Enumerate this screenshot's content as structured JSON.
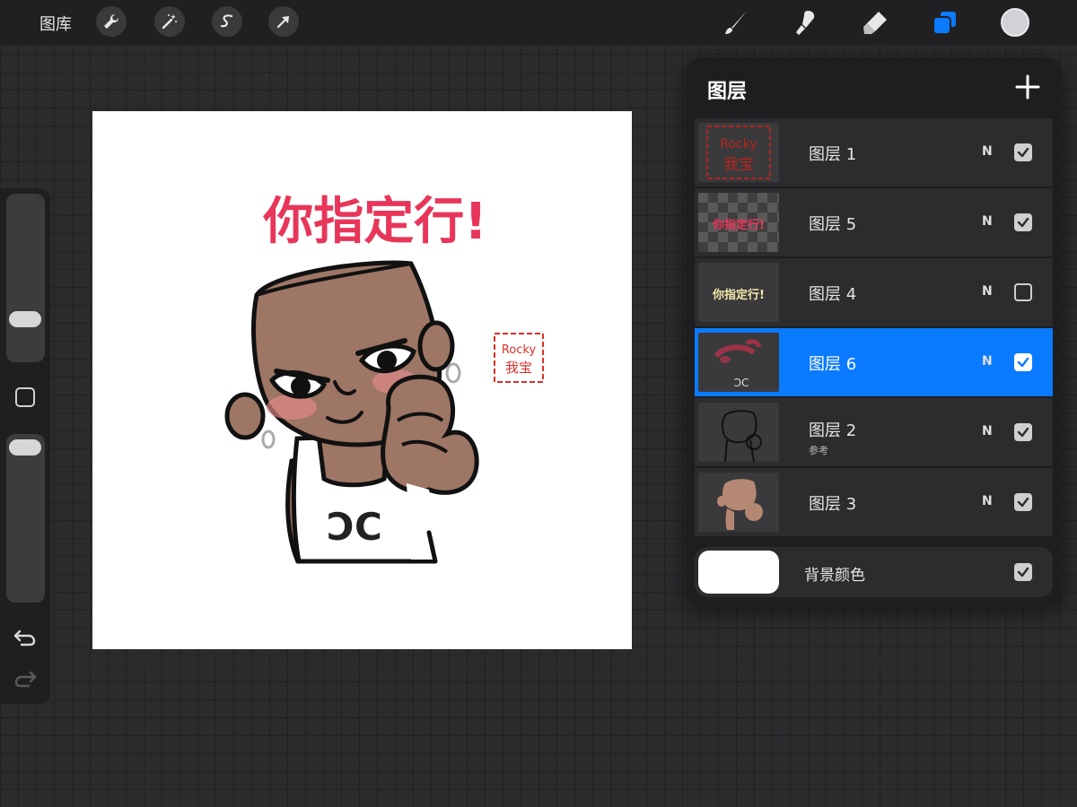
{
  "topbar": {
    "gallery_label": "图库",
    "left_tools": [
      "wrench-icon",
      "magic-wand-icon",
      "selection-icon",
      "transform-arrow-icon"
    ],
    "right_tools": [
      "brush-icon",
      "smudge-icon",
      "eraser-icon",
      "layers-icon"
    ],
    "current_color": "#d1d1d6",
    "accent_color": "#0a7aff"
  },
  "canvas": {
    "caption": "你指定行!",
    "stamp_line1": "Rocky",
    "stamp_line2": "我宝",
    "caption_color": "#e8365a",
    "skin_color": "#9e7665"
  },
  "layers_panel": {
    "title": "图层",
    "layers": [
      {
        "name": "图层 1",
        "blend": "N",
        "visible": true,
        "selected": false,
        "sublabel": ""
      },
      {
        "name": "图层 5",
        "blend": "N",
        "visible": true,
        "selected": false,
        "sublabel": ""
      },
      {
        "name": "图层 4",
        "blend": "N",
        "visible": false,
        "selected": false,
        "sublabel": ""
      },
      {
        "name": "图层 6",
        "blend": "N",
        "visible": true,
        "selected": true,
        "sublabel": ""
      },
      {
        "name": "图层 2",
        "blend": "N",
        "visible": true,
        "selected": false,
        "sublabel": "参考"
      },
      {
        "name": "图层 3",
        "blend": "N",
        "visible": true,
        "selected": false,
        "sublabel": ""
      }
    ],
    "background": {
      "label": "背景颜色",
      "color": "#ffffff",
      "visible": true
    },
    "thumb_texts": {
      "layer1_l1": "Rocky",
      "layer1_l2": "我宝",
      "layer5": "你指定行!",
      "layer4": "你指定行!"
    }
  }
}
